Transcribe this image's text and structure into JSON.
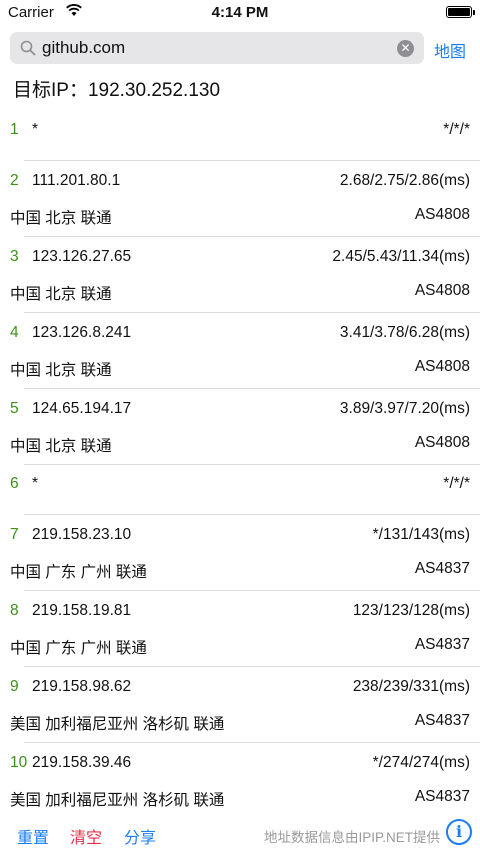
{
  "status_bar": {
    "carrier": "Carrier",
    "time": "4:14 PM"
  },
  "search": {
    "value": "github.com",
    "map_label": "地图"
  },
  "target": {
    "label": "目标IP：192.30.252.130"
  },
  "hops": [
    {
      "num": "1",
      "ip": "*",
      "times": "*/*/*",
      "location": "",
      "asn": ""
    },
    {
      "num": "2",
      "ip": "111.201.80.1",
      "times": "2.68/2.75/2.86(ms)",
      "location": "中国 北京  联通",
      "asn": "AS4808"
    },
    {
      "num": "3",
      "ip": "123.126.27.65",
      "times": "2.45/5.43/11.34(ms)",
      "location": "中国 北京  联通",
      "asn": "AS4808"
    },
    {
      "num": "4",
      "ip": "123.126.8.241",
      "times": "3.41/3.78/6.28(ms)",
      "location": "中国 北京  联通",
      "asn": "AS4808"
    },
    {
      "num": "5",
      "ip": "124.65.194.17",
      "times": "3.89/3.97/7.20(ms)",
      "location": "中国 北京  联通",
      "asn": "AS4808"
    },
    {
      "num": "6",
      "ip": "*",
      "times": "*/*/*",
      "location": "",
      "asn": ""
    },
    {
      "num": "7",
      "ip": "219.158.23.10",
      "times": "*/131/143(ms)",
      "location": "中国 广东 广州  联通",
      "asn": "AS4837"
    },
    {
      "num": "8",
      "ip": "219.158.19.81",
      "times": "123/123/128(ms)",
      "location": "中国 广东 广州  联通",
      "asn": "AS4837"
    },
    {
      "num": "9",
      "ip": "219.158.98.62",
      "times": "238/239/331(ms)",
      "location": "美国 加利福尼亚州 洛杉矶  联通",
      "asn": "AS4837"
    },
    {
      "num": "10",
      "ip": "219.158.39.46",
      "times": "*/274/274(ms)",
      "location": "美国 加利福尼亚州 洛杉矶  联通",
      "asn": "AS4837"
    }
  ],
  "bottom": {
    "reset_label": "重置",
    "clear_label": "清空",
    "share_label": "分享",
    "data_source": "地址数据信息由IPIP.NET提供"
  },
  "colors": {
    "accent": "#1a7df2",
    "danger": "#e8304a",
    "hop_number": "#3d8f1c"
  },
  "icons": [
    "wifi-icon",
    "battery-icon",
    "search-icon",
    "clear-icon",
    "info-icon"
  ]
}
